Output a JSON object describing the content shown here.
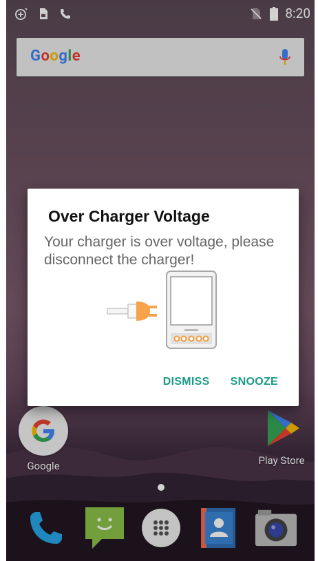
{
  "status_bar": {
    "time": "8:20",
    "icons_left": [
      "add-alarm-icon",
      "sim-icon",
      "phone-call-icon"
    ],
    "icons_right": [
      "no-sim-icon",
      "battery-icon"
    ]
  },
  "search": {
    "brand": [
      "G",
      "o",
      "o",
      "g",
      "l",
      "e"
    ],
    "mic_icon": "mic-icon"
  },
  "home": {
    "apps": [
      {
        "label": "Google",
        "icon": "google-icon"
      },
      {
        "label": "Play Store",
        "icon": "play-store-icon"
      }
    ],
    "dock": [
      "phone-icon",
      "messaging-icon",
      "app-drawer-icon",
      "contacts-icon",
      "camera-icon"
    ]
  },
  "dialog": {
    "title": "Over Charger Voltage",
    "message": "Your charger is over voltage, please disconnect the charger!",
    "illustration": "charger-plug-phone-icon",
    "buttons": {
      "dismiss": "DISMISS",
      "snooze": "SNOOZE"
    }
  },
  "colors": {
    "accent": "#1a9a86",
    "dialog_bg": "#ffffff",
    "title": "#111111",
    "message": "#666666"
  }
}
